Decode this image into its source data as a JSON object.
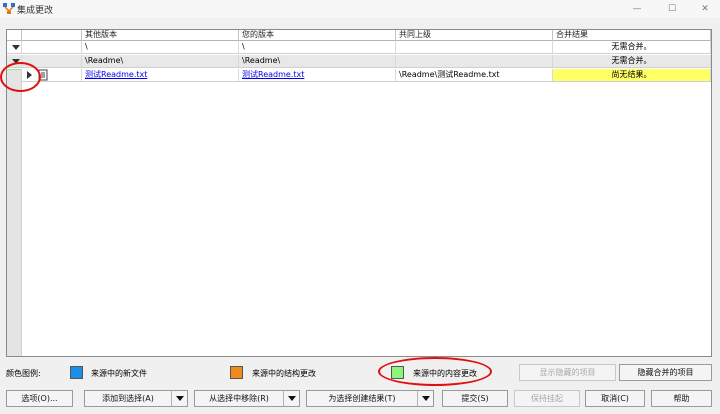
{
  "window": {
    "title": "集成更改",
    "minimize": "—",
    "maximize": "☐",
    "close": "✕"
  },
  "columns": [
    "其他版本",
    "您的版本",
    "共同上级",
    "合并结果"
  ],
  "rows": [
    {
      "other": "\\",
      "yours": "\\",
      "base": "",
      "result": "无需合并。"
    },
    {
      "other": "\\Readme\\",
      "yours": "\\Readme\\",
      "base": "",
      "result": "无需合并。"
    },
    {
      "other": "测试Readme.txt",
      "yours": "测试Readme.txt",
      "base": "\\Readme\\测试Readme.txt",
      "result": "尚无结果。"
    }
  ],
  "legend": {
    "label": "颜色图例:",
    "items": [
      {
        "text": "来源中的新文件",
        "color": "#1a8fe8"
      },
      {
        "text": "来源中的结构更改",
        "color": "#ef8a1f"
      },
      {
        "text": "来源中的内容更改",
        "color": "#8ef37a"
      }
    ]
  },
  "buttons": {
    "show_hidden": "显示隐藏的项目",
    "hide_merged": "隐藏合并的项目",
    "options": "选项(O)...",
    "add_to_selection": "添加到选择(A)",
    "remove_from_selection": "从选择中移除(R)",
    "create_results": "为选择创建结果(T)",
    "submit": "提交(S)",
    "keep_pending": "保持挂起",
    "cancel": "取消(C)",
    "help": "帮助"
  },
  "colors": {
    "result_pending": "#ffff66",
    "content_change": "#8ef37a",
    "annotation": "#e01010"
  }
}
